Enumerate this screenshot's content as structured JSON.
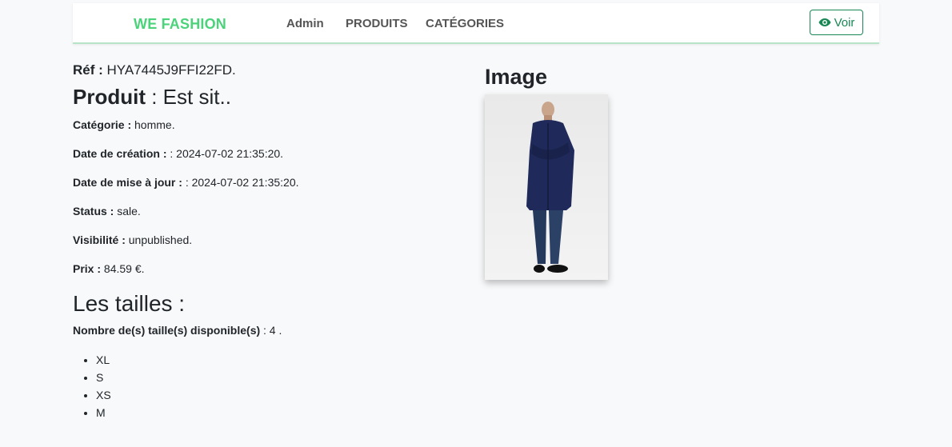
{
  "navbar": {
    "brand": "WE FASHION",
    "links": [
      "Admin",
      "PRODUITS",
      "CATÉGORIES"
    ],
    "voir_label": "Voir"
  },
  "product": {
    "ref_label": "Réf :",
    "ref_value": "HYA7445J9FFI22FD.",
    "produit_label": "Produit",
    "produit_value": ": Est sit..",
    "fields": [
      {
        "label": "Catégorie :",
        "value": "homme."
      },
      {
        "label": "Date de création :",
        "value": ": 2024-07-02 21:35:20."
      },
      {
        "label": "Date de mise à jour :",
        "value": ": 2024-07-02 21:35:20."
      },
      {
        "label": "Status :",
        "value": "sale."
      },
      {
        "label": "Visibilité :",
        "value": "unpublished."
      },
      {
        "label": "Prix :",
        "value": "84.59 €."
      }
    ]
  },
  "sizes": {
    "title": "Les tailles :",
    "count_label": "Nombre de(s) taille(s) disponible(s)",
    "count_value": ": 4 .",
    "items": [
      "XL",
      "S",
      "XS",
      "M"
    ]
  },
  "image": {
    "title": "Image"
  },
  "colors": {
    "brand": "#4ad37a",
    "accent": "#198754"
  }
}
